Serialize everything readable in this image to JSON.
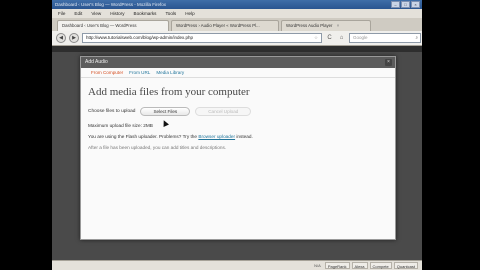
{
  "window": {
    "title": "Dashboard ‹ User's Blog — WordPress - Mozilla Firefox",
    "buttons": [
      "–",
      "□",
      "×"
    ]
  },
  "menu": [
    "File",
    "Edit",
    "View",
    "History",
    "Bookmarks",
    "Tools",
    "Help"
  ],
  "tabs": [
    {
      "label": "Dashboard ‹ User's Blog — WordPress",
      "active": true
    },
    {
      "label": "WordPress › Audio Player « WordPress Pl...",
      "active": false
    },
    {
      "label": "WordPress Audio Player",
      "active": false
    }
  ],
  "tab_close_glyph": "×",
  "nav": {
    "back_glyph": "◀",
    "forward_glyph": "▶",
    "url": "http://www.tutorialsweb.com/blog/wp-admin/index.php",
    "star_glyph": "☆",
    "reload_glyph": "C",
    "home_glyph": "⌂",
    "search_placeholder": "Google",
    "search_glyph": "⌕",
    "icons": [
      "refresh-icon",
      "star-icon",
      "home-icon",
      "search-icon"
    ]
  },
  "modal": {
    "title": "Add Audio",
    "close_glyph": "×",
    "tabs": [
      {
        "label": "From Computer",
        "current": true
      },
      {
        "label": "From URL",
        "current": false
      },
      {
        "label": "Media Library",
        "current": false
      }
    ],
    "heading": "Add media files from your computer",
    "choose_label": "Choose files to upload",
    "select_button": "Select Files",
    "cancel_button": "Cancel Upload",
    "max_size": "Maximum upload file size: 2MB",
    "flash_text_before": "You are using the Flash uploader. Problems? Try the",
    "flash_link": "Browser uploader",
    "flash_text_after": "instead.",
    "after_upload": "After a file has been uploaded, you can add titles and descriptions."
  },
  "statusbar": {
    "items": [
      "PageRank",
      "Alexa",
      "Compete",
      "Quantcast"
    ],
    "badge": "N/A"
  },
  "colors": {
    "link": "#21759b",
    "current_tab": "#d54e21",
    "modal_header": "#5c5c5c"
  }
}
